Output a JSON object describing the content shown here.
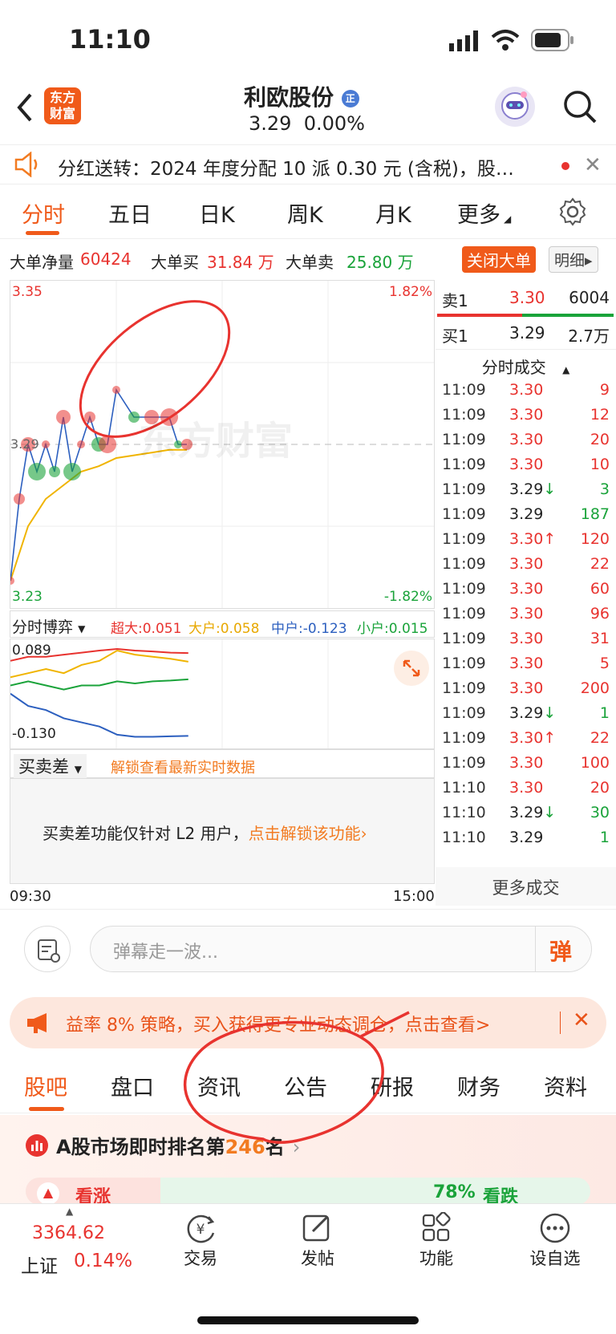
{
  "status": {
    "time": "11:10"
  },
  "header": {
    "title": "利欧股份",
    "logo_line1": "东方",
    "logo_line2": "财富",
    "badge": "正",
    "price": "3.29",
    "change": "0.00%"
  },
  "notice": {
    "text": "分红送转：2024 年度分配 10 派 0.30 元 (含税)，股…"
  },
  "tabs": [
    "分时",
    "五日",
    "日K",
    "周K",
    "月K",
    "更多"
  ],
  "bigorder": {
    "label1": "大单净量",
    "val1": "60424",
    "label2": "大单买",
    "val2": "31.84 万",
    "label3": "大单卖",
    "val3": "25.80 万",
    "close_btn": "关闭大单",
    "detail_btn": "明细"
  },
  "chart_data": [
    {
      "type": "line",
      "title": "",
      "ylim": [
        3.23,
        3.35
      ],
      "y_ticks_left": [
        "3.35",
        "3.23"
      ],
      "y_ticks_right": [
        "1.82%",
        "-1.82%"
      ],
      "mid_label": "3.29",
      "x_ticks": [
        "09:30",
        "15:00"
      ],
      "series": [
        {
          "x": [
            "09:30",
            "09:35",
            "09:40",
            "09:45",
            "09:50",
            "09:55",
            "10:00",
            "10:05",
            "10:10",
            "10:15",
            "10:20",
            "10:25",
            "10:30",
            "10:40",
            "10:50",
            "11:00",
            "11:05",
            "11:10"
          ],
          "values": [
            3.24,
            3.27,
            3.29,
            3.28,
            3.29,
            3.28,
            3.3,
            3.28,
            3.29,
            3.3,
            3.29,
            3.29,
            3.31,
            3.3,
            3.3,
            3.3,
            3.29,
            3.29
          ]
        },
        {
          "x": [
            "09:30",
            "09:40",
            "09:50",
            "10:00",
            "10:10",
            "10:20",
            "10:30",
            "10:40",
            "10:50",
            "11:00",
            "11:10"
          ],
          "values": [
            3.24,
            3.26,
            3.27,
            3.275,
            3.28,
            3.282,
            3.285,
            3.286,
            3.287,
            3.288,
            3.288
          ]
        }
      ]
    },
    {
      "type": "line",
      "title": "分时博弈",
      "ylim": [
        -0.13,
        0.089
      ],
      "y_ticks": [
        "0.089",
        "-0.130"
      ],
      "series": [
        {
          "name": "超大",
          "color": "#e8332f",
          "values": [
            0.06,
            0.07,
            0.07,
            0.075,
            0.08,
            0.085,
            0.089,
            0.085,
            0.083,
            0.08,
            0.079
          ]
        },
        {
          "name": "大户",
          "color": "#f0b400",
          "values": [
            0.02,
            0.03,
            0.04,
            0.03,
            0.05,
            0.06,
            0.085,
            0.075,
            0.07,
            0.065,
            0.058
          ]
        },
        {
          "name": "中户",
          "color": "#2c5fbf",
          "values": [
            -0.02,
            -0.05,
            -0.06,
            -0.08,
            -0.09,
            -0.1,
            -0.12,
            -0.125,
            -0.125,
            -0.124,
            -0.123
          ]
        },
        {
          "name": "小户",
          "color": "#1aa33a",
          "values": [
            0.0,
            0.01,
            0.0,
            -0.01,
            0.0,
            0.0,
            0.01,
            0.005,
            0.01,
            0.012,
            0.015
          ]
        }
      ]
    }
  ],
  "gamebox": {
    "label": "分时博弈",
    "chao": "超大:0.051",
    "dahu": "大户:0.058",
    "zhong": "中户:-0.123",
    "xiao": "小户:0.015"
  },
  "maimai": {
    "label": "买卖差",
    "unlock": "解锁查看最新实时数据",
    "lock_text": "买卖差功能仅针对 L2 用户，",
    "lock_link": "点击解锁该功能"
  },
  "orderbook": {
    "sell_label": "卖1",
    "sell_price": "3.30",
    "sell_vol": "6004",
    "buy_label": "买1",
    "buy_price": "3.29",
    "buy_vol": "2.7万"
  },
  "ticks_header": "分时成交",
  "ticks": [
    {
      "t": "11:09",
      "p": "3.30",
      "c": "red",
      "a": "",
      "v": "9",
      "vc": "red"
    },
    {
      "t": "11:09",
      "p": "3.30",
      "c": "red",
      "a": "",
      "v": "12",
      "vc": "red"
    },
    {
      "t": "11:09",
      "p": "3.30",
      "c": "red",
      "a": "",
      "v": "20",
      "vc": "red"
    },
    {
      "t": "11:09",
      "p": "3.30",
      "c": "red",
      "a": "",
      "v": "10",
      "vc": "red"
    },
    {
      "t": "11:09",
      "p": "3.29",
      "c": "dark",
      "a": "↓",
      "v": "3",
      "vc": "green"
    },
    {
      "t": "11:09",
      "p": "3.29",
      "c": "dark",
      "a": "",
      "v": "187",
      "vc": "green"
    },
    {
      "t": "11:09",
      "p": "3.30",
      "c": "red",
      "a": "↑",
      "v": "120",
      "vc": "red"
    },
    {
      "t": "11:09",
      "p": "3.30",
      "c": "red",
      "a": "",
      "v": "22",
      "vc": "red"
    },
    {
      "t": "11:09",
      "p": "3.30",
      "c": "red",
      "a": "",
      "v": "60",
      "vc": "red"
    },
    {
      "t": "11:09",
      "p": "3.30",
      "c": "red",
      "a": "",
      "v": "96",
      "vc": "red"
    },
    {
      "t": "11:09",
      "p": "3.30",
      "c": "red",
      "a": "",
      "v": "31",
      "vc": "red"
    },
    {
      "t": "11:09",
      "p": "3.30",
      "c": "red",
      "a": "",
      "v": "5",
      "vc": "red"
    },
    {
      "t": "11:09",
      "p": "3.30",
      "c": "red",
      "a": "",
      "v": "200",
      "vc": "red"
    },
    {
      "t": "11:09",
      "p": "3.29",
      "c": "dark",
      "a": "↓",
      "v": "1",
      "vc": "green"
    },
    {
      "t": "11:09",
      "p": "3.30",
      "c": "red",
      "a": "↑",
      "v": "22",
      "vc": "red"
    },
    {
      "t": "11:09",
      "p": "3.30",
      "c": "red",
      "a": "",
      "v": "100",
      "vc": "red"
    },
    {
      "t": "11:10",
      "p": "3.30",
      "c": "red",
      "a": "",
      "v": "20",
      "vc": "red"
    },
    {
      "t": "11:10",
      "p": "3.29",
      "c": "dark",
      "a": "↓",
      "v": "30",
      "vc": "green"
    },
    {
      "t": "11:10",
      "p": "3.29",
      "c": "dark",
      "a": "",
      "v": "1",
      "vc": "green"
    }
  ],
  "more_deals": "更多成交",
  "danmu": {
    "placeholder": "弹幕走一波...",
    "btn": "弹"
  },
  "promo": {
    "text": "益率 8% 策略，买入获得更专业动态调仓，点击查看>"
  },
  "bottom_tabs": [
    "股吧",
    "盘口",
    "资讯",
    "公告",
    "研报",
    "财务",
    "资料"
  ],
  "rank": {
    "text1": "A股市场即时排名第",
    "num": "246",
    "text2": "名"
  },
  "vote": {
    "up": "看涨",
    "down": "看跌",
    "pct": "78%"
  },
  "watermark": "东方财富",
  "nav": {
    "index_val": "3364.62",
    "index_name": "上证",
    "index_chg": "0.14%",
    "items": [
      "交易",
      "发帖",
      "功能",
      "设自选"
    ]
  }
}
